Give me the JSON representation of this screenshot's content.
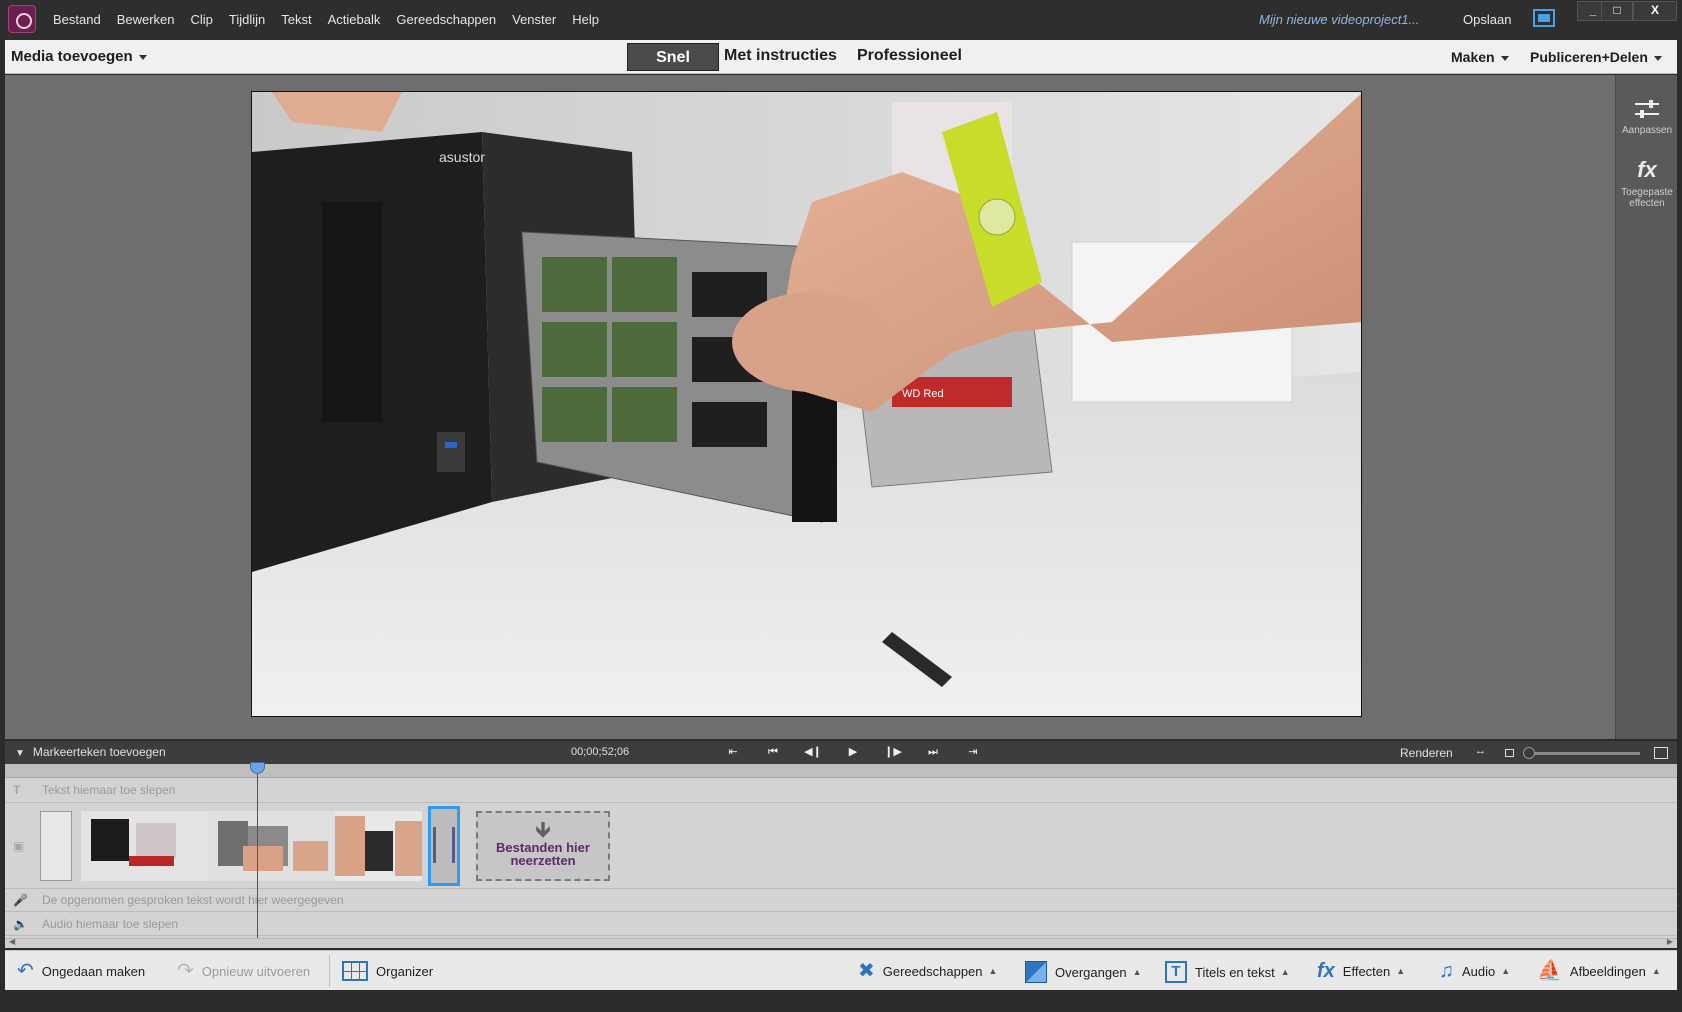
{
  "window": {
    "menu": [
      "Bestand",
      "Bewerken",
      "Clip",
      "Tijdlijn",
      "Tekst",
      "Actiebalk",
      "Gereedschappen",
      "Venster",
      "Help"
    ],
    "project_name": "Mijn nieuwe videoproject1...",
    "save_label": "Opslaan",
    "minimize": "_",
    "maximize": "□",
    "close": "X"
  },
  "modebar": {
    "add_media": "Media toevoegen",
    "modes": [
      "Snel",
      "Met instructies",
      "Professioneel"
    ],
    "active_mode": "Snel",
    "make": "Maken",
    "publish": "Publiceren+Delen"
  },
  "right_panel": {
    "adjust": "Aanpassen",
    "applied_effects": "Toegepaste effecten"
  },
  "preview": {
    "labels": [
      "asustor",
      "WD Red"
    ]
  },
  "timeline": {
    "add_marker": "Markeerteken toevoegen",
    "timecode": "00;00;52;06",
    "render": "Renderen",
    "text_track": "Tekst hiemaar toe slepen",
    "narration_track": "De opgenomen gesproken tekst wordt hier weergegeven",
    "audio_track": "Audio hiemaar toe slepen",
    "drop_files": "Bestanden hier neerzetten"
  },
  "actionbar": {
    "undo": "Ongedaan maken",
    "redo": "Opnieuw uitvoeren",
    "organizer": "Organizer",
    "tools": "Gereedschappen",
    "transitions": "Overgangen",
    "titles": "Titels en tekst",
    "effects": "Effecten",
    "audio": "Audio",
    "graphics": "Afbeeldingen"
  }
}
